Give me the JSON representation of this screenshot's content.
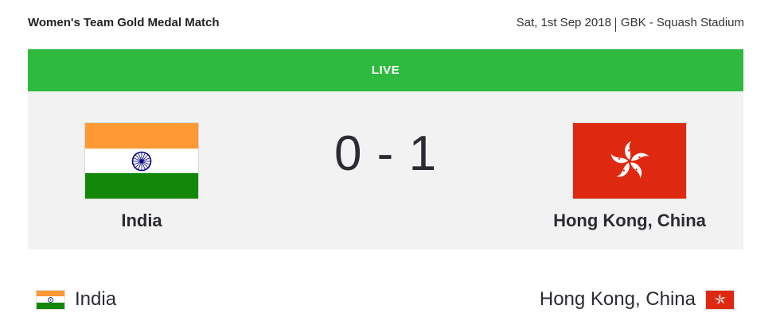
{
  "header": {
    "title": "Women's Team Gold Medal Match",
    "date": "Sat, 1st Sep 2018",
    "venue": "GBK - Squash Stadium"
  },
  "status": {
    "label": "LIVE",
    "color": "#2dba3e"
  },
  "home": {
    "name": "India",
    "score": "0",
    "flag": "india-flag"
  },
  "away": {
    "name": "Hong Kong, China",
    "score": "1",
    "flag": "hong-kong-flag"
  },
  "score_separator": "-"
}
